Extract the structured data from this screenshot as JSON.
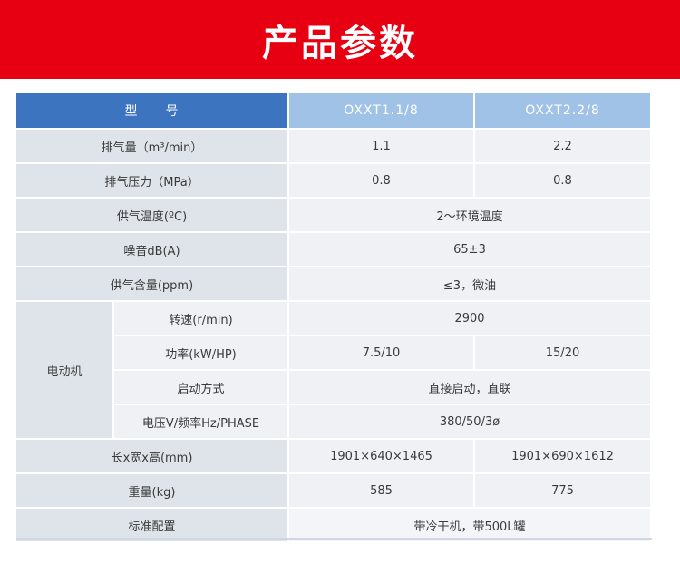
{
  "banner": {
    "title": "产品参数"
  },
  "table": {
    "header": {
      "label": "型　　号",
      "models": [
        "OXXT1.1/8",
        "OXXT2.2/8"
      ]
    },
    "rows": {
      "exhaust": {
        "label": "排气量（m³/min）",
        "v1": "1.1",
        "v2": "2.2"
      },
      "pressure": {
        "label": "排气压力（MPa）",
        "v1": "0.8",
        "v2": "0.8"
      },
      "temperature": {
        "label": "供气温度(ºC)",
        "value": "2～环境温度"
      },
      "noise": {
        "label": "噪音dB(A)",
        "value": "65±3"
      },
      "oil": {
        "label": "供气含量(ppm)",
        "value": "≤3，微油"
      },
      "motor": {
        "label": "电动机",
        "speed": {
          "label": "转速(r/min)",
          "value": "2900"
        },
        "power": {
          "label": "功率(kW/HP)",
          "v1": "7.5/10",
          "v2": "15/20"
        },
        "start": {
          "label": "启动方式",
          "value": "直接启动，直联"
        },
        "voltage": {
          "label": "电压V/频率Hz/PHASE",
          "value": "380/50/3ø"
        }
      },
      "dimensions": {
        "label": "长x宽x高(mm)",
        "v1": "1901×640×1465",
        "v2": "1901×690×1612"
      },
      "weight": {
        "label": "重量(kg)",
        "v1": "585",
        "v2": "775"
      },
      "config": {
        "label": "标准配置",
        "value": "带冷干机，带500L罐"
      }
    }
  }
}
